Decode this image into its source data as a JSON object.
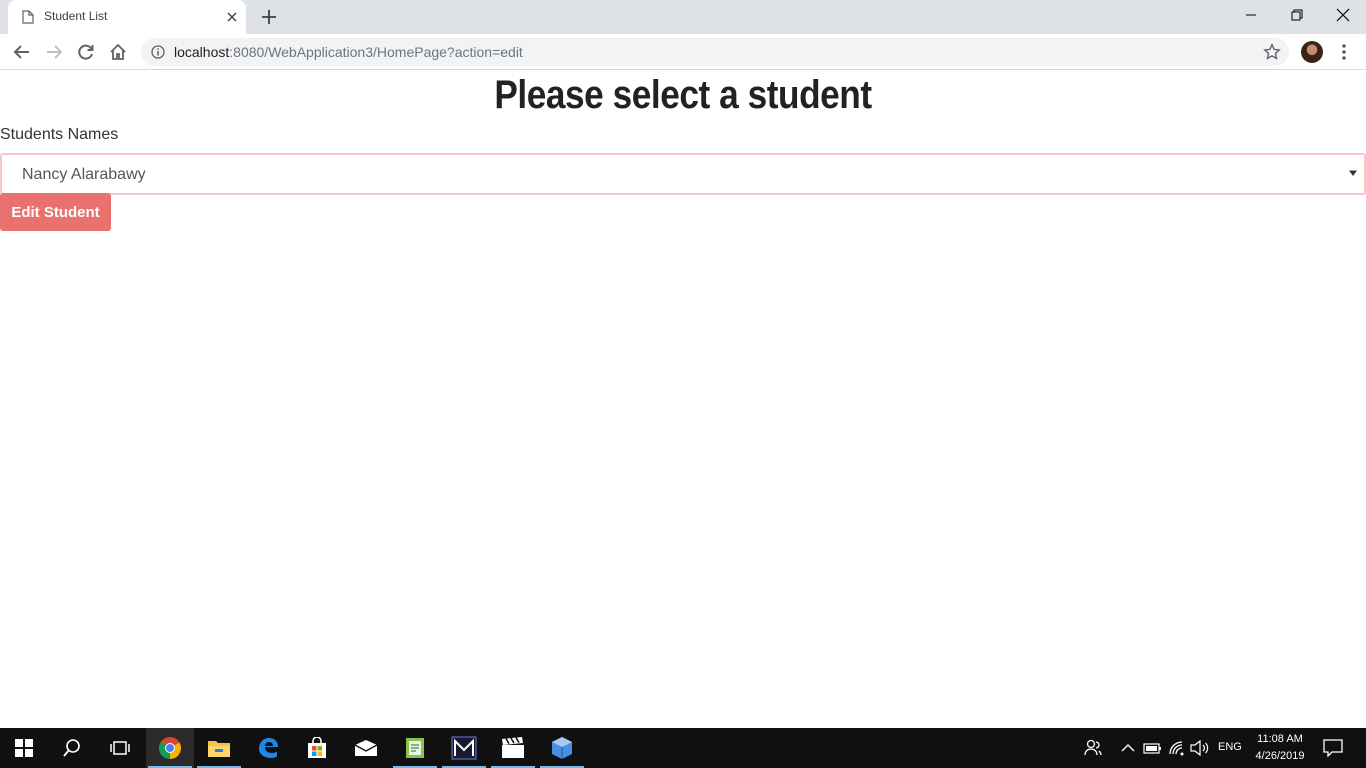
{
  "browser": {
    "tab": {
      "title": "Student List"
    },
    "url": {
      "host": "localhost",
      "rest": ":8080/WebApplication3/HomePage?action=edit"
    }
  },
  "page": {
    "heading": "Please select a student",
    "field_label": "Students Names",
    "selected_student": "Nancy Alarabawy",
    "button_label": "Edit Student"
  },
  "taskbar": {
    "language": "ENG",
    "time": "11:08 AM",
    "date": "4/26/2019"
  },
  "colors": {
    "button": "#e9716e",
    "select_border": "#f7c6c6",
    "tabstrip": "#dee1e6",
    "taskbar": "#101010"
  }
}
